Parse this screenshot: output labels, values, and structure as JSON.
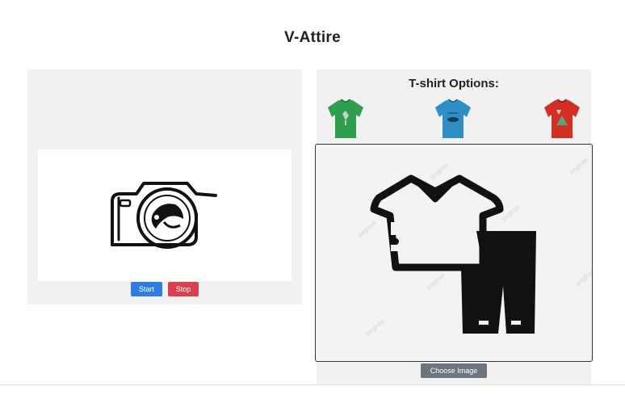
{
  "app": {
    "title": "V-Attire"
  },
  "camera_panel": {
    "start_label": "Start",
    "stop_label": "Stop"
  },
  "options_panel": {
    "title": "T-shirt Options:",
    "tshirts": [
      {
        "name": "green-tshirt",
        "color": "#2e9e4f"
      },
      {
        "name": "blue-tshirt",
        "color": "#2e8fc4"
      },
      {
        "name": "red-tshirt",
        "color": "#d32f24"
      }
    ],
    "choose_label": "Choose Image"
  }
}
